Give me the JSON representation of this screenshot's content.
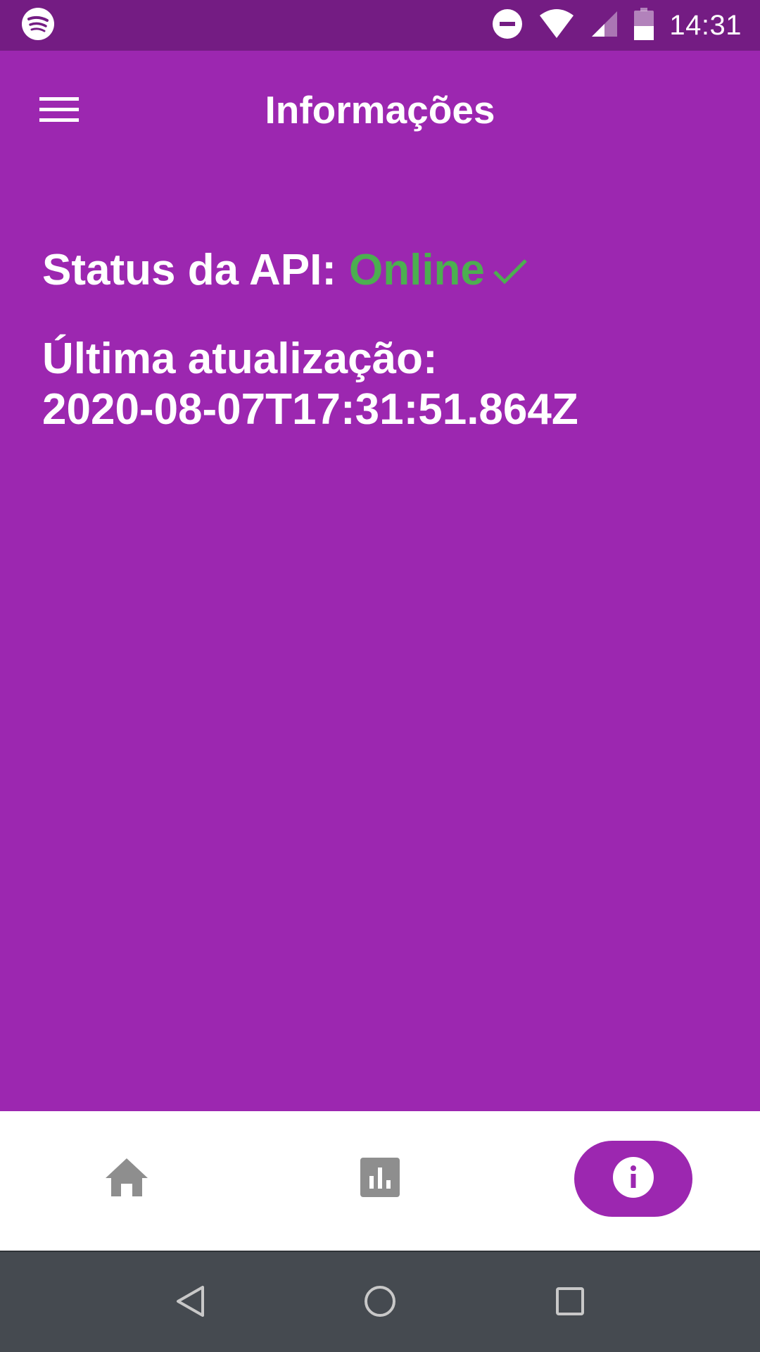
{
  "status_bar": {
    "time": "14:31",
    "icons": [
      "spotify-icon",
      "do-not-disturb-icon",
      "wifi-icon",
      "cellular-signal-icon",
      "battery-icon"
    ]
  },
  "app_bar": {
    "title": "Informações",
    "menu_icon": "hamburger-menu-icon"
  },
  "api_status": {
    "label": "Status da API:",
    "value": "Online",
    "value_color": "#4caf50",
    "status_icon": "check-icon"
  },
  "last_update": {
    "label": "Última atualização:",
    "value": "2020-08-07T17:31:51.864Z"
  },
  "bottom_nav": {
    "items": [
      {
        "icon": "home-icon",
        "active": false
      },
      {
        "icon": "bar-chart-icon",
        "active": false
      },
      {
        "icon": "info-icon",
        "active": true
      }
    ]
  },
  "system_nav": {
    "buttons": [
      "back-icon",
      "home-circle-icon",
      "recents-icon"
    ]
  },
  "colors": {
    "primary": "#9c27b0",
    "status_bar": "#741c83",
    "success": "#4caf50",
    "nav_inactive": "#8e8e8e",
    "system_nav": "#454a50"
  }
}
